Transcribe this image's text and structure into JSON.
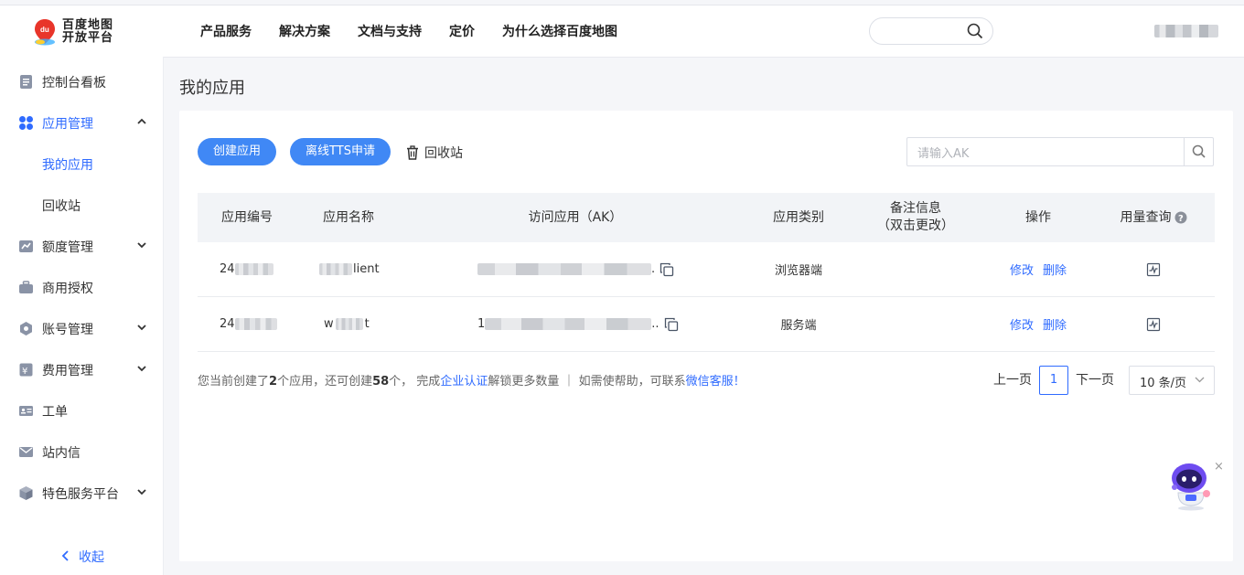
{
  "header": {
    "logo_line1": "百度地图",
    "logo_line2": "开放平台",
    "nav": [
      "产品服务",
      "解决方案",
      "文档与支持",
      "定价",
      "为什么选择百度地图"
    ]
  },
  "sidebar": {
    "items": [
      {
        "label": "控制台看板",
        "icon": "dashboard-icon"
      },
      {
        "label": "应用管理",
        "icon": "app-grid-icon"
      },
      {
        "label": "我的应用"
      },
      {
        "label": "回收站"
      },
      {
        "label": "额度管理",
        "icon": "quota-chart-icon"
      },
      {
        "label": "商用授权",
        "icon": "briefcase-icon"
      },
      {
        "label": "账号管理",
        "icon": "account-gear-icon"
      },
      {
        "label": "费用管理",
        "icon": "billing-icon"
      },
      {
        "label": "工单",
        "icon": "ticket-icon"
      },
      {
        "label": "站内信",
        "icon": "mail-icon"
      },
      {
        "label": "特色服务平台",
        "icon": "cube-icon"
      }
    ],
    "collapse_label": "收起"
  },
  "main": {
    "page_title": "我的应用",
    "create_button": "创建应用",
    "tts_button": "离线TTS申请",
    "recycle_label": "回收站",
    "search_placeholder": "请输入AK",
    "table": {
      "headers": [
        "应用编号",
        "应用名称",
        "访问应用（AK）",
        "应用类别",
        "备注信息",
        "（双击更改）",
        "操作",
        "用量查询"
      ],
      "rows": [
        {
          "id_prefix": "24",
          "name_prefix": "",
          "name_suffix": "lient",
          "ak_prefix": "",
          "ak_suffix": ".",
          "category": "浏览器端",
          "edit": "修改",
          "delete": "删除"
        },
        {
          "id_prefix": "24",
          "name_prefix": "w",
          "name_suffix": "t",
          "ak_prefix": "1",
          "ak_suffix": "..",
          "category": "服务端",
          "edit": "修改",
          "delete": "删除"
        }
      ]
    },
    "footer": {
      "t1": "您当前创建了",
      "count_created": "2",
      "t2": "个应用，还可创建",
      "count_remaining": "58",
      "t3": "个， 完成",
      "enterprise_link": "企业认证",
      "t4": "解锁更多数量 ｜ 如需使\u0010帮助，可联系",
      "wechat_link": "微信客服！"
    },
    "pagination": {
      "prev": "上一页",
      "current_page": "1",
      "next": "下一页",
      "page_size": "10 条/页"
    }
  },
  "colors": {
    "accent": "#2f6bff",
    "primary_button": "#4088f5",
    "table_header_bg": "#f2f4f7",
    "page_bg": "#f5f6f9"
  }
}
